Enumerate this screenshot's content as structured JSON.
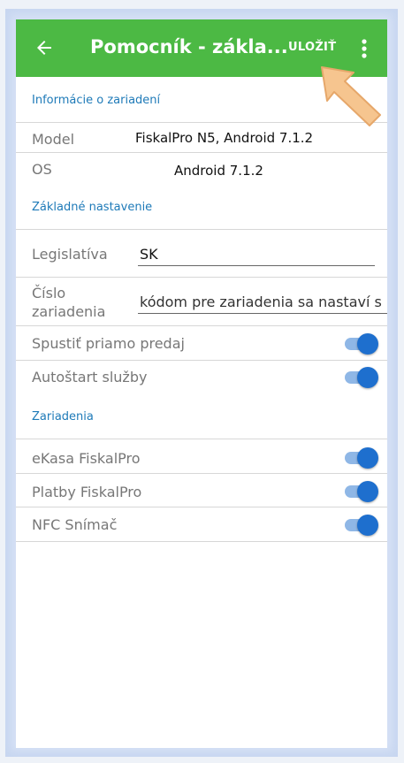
{
  "appbar": {
    "title": "Pomocník - zákla...",
    "save_label": "ULOŽIŤ",
    "back_icon": "arrow-left-icon",
    "more_icon": "more-vert-icon",
    "color": "#4cb944"
  },
  "device_info": {
    "heading": "Informácie o zariadení",
    "model_label": "Model",
    "model_value": "FiskalPro N5, Android 7.1.2",
    "os_label": "OS",
    "os_value": "Android 7.1.2"
  },
  "basic_settings": {
    "heading": "Základné nastavenie",
    "legislation_label": "Legislatíva",
    "legislation_value": "SK",
    "device_number_label_1": "Číslo",
    "device_number_label_2": "zariadenia",
    "device_number_value": "kódom pre zariadenia sa nastaví s",
    "direct_sale_label": "Spustiť priamo predaj",
    "direct_sale_on": true,
    "autostart_label": "Autoštart služby",
    "autostart_on": true
  },
  "devices": {
    "heading": "Zariadenia",
    "ekasa_label": "eKasa FiskalPro",
    "ekasa_on": true,
    "payments_label": "Platby FiskalPro",
    "payments_on": true,
    "nfc_label": "NFC Snímač",
    "nfc_on": true
  },
  "colors": {
    "accent": "#1e7ab8",
    "toggle_on": "#1e6fce",
    "pointer": "#f6c58f"
  }
}
